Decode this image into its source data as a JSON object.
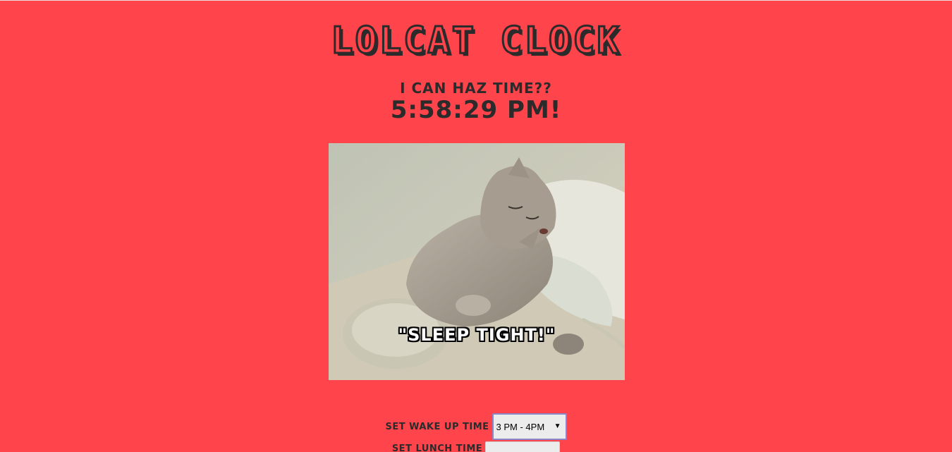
{
  "header": {
    "title": "Lolcat Clock",
    "subtitle": "I can haz time??",
    "clock_time": "5:58:29 PM!"
  },
  "photo": {
    "caption": "\"SLEEP TIGHT!\"",
    "subject": "sleeping-kitten"
  },
  "controls": {
    "wake_label": "Set wake up time",
    "wake_value": "3 PM - 4PM",
    "lunch_label": "Set lunch time",
    "lunch_value": ""
  },
  "colors": {
    "background": "#ff444b",
    "text": "#2b2b2b"
  }
}
